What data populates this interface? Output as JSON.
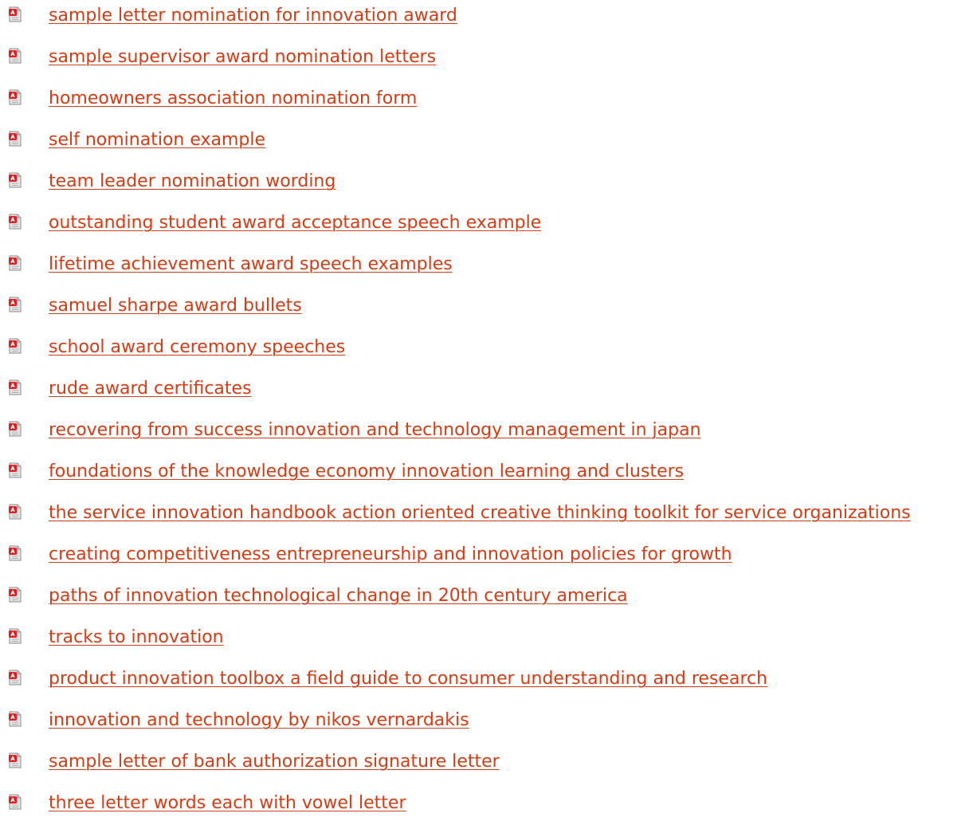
{
  "colors": {
    "link": "#d53c14",
    "icon_red": "#e02020",
    "icon_paper": "#e6e6e6",
    "background": "#ffffff"
  },
  "icon": "pdf-document-icon",
  "links": [
    {
      "label": "sample letter nomination for innovation award"
    },
    {
      "label": "sample supervisor award nomination letters"
    },
    {
      "label": "homeowners association nomination form"
    },
    {
      "label": "self nomination example"
    },
    {
      "label": "team leader nomination wording"
    },
    {
      "label": "outstanding student award acceptance speech example"
    },
    {
      "label": "lifetime achievement award speech examples"
    },
    {
      "label": "samuel sharpe award bullets"
    },
    {
      "label": "school award ceremony speeches"
    },
    {
      "label": "rude award certificates"
    },
    {
      "label": "recovering from success innovation and technology management in japan"
    },
    {
      "label": "foundations of the knowledge economy innovation learning and clusters"
    },
    {
      "label": "the service innovation handbook action oriented creative thinking toolkit for service organizations"
    },
    {
      "label": "creating competitiveness entrepreneurship and innovation policies for growth"
    },
    {
      "label": "paths of innovation technological change in 20th century america"
    },
    {
      "label": "tracks to innovation"
    },
    {
      "label": "product innovation toolbox a field guide to consumer understanding and research"
    },
    {
      "label": "innovation and technology by nikos vernardakis"
    },
    {
      "label": "sample letter of bank authorization signature letter"
    },
    {
      "label": "three letter words each with vowel letter"
    }
  ]
}
